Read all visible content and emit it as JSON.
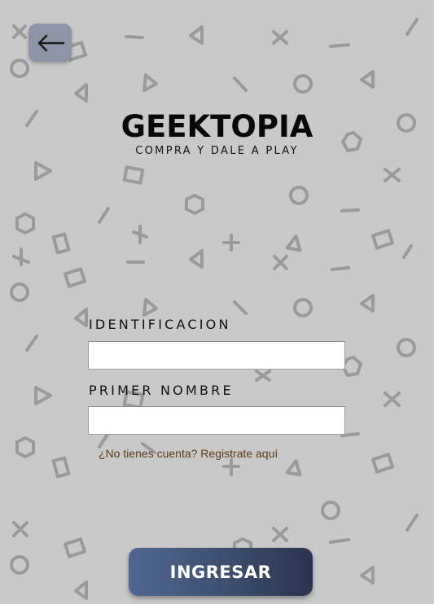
{
  "header": {
    "back_icon": "arrow-left-icon"
  },
  "brand": {
    "title": "GEEKTOPIA",
    "tagline": "COMPRA Y DALE A PLAY"
  },
  "form": {
    "identification_label": "IDENTIFICACION",
    "identification_value": "",
    "first_name_label": "PRIMER NOMBRE",
    "first_name_value": "",
    "register_link": "¿No tienes cuenta? Registrate aquí",
    "submit_label": "INGRESAR"
  },
  "colors": {
    "background": "#c9c9c9",
    "pattern": "#9a9a9a",
    "button_start": "#4f6891",
    "button_end": "#2a3350",
    "link": "#5a3a14"
  }
}
